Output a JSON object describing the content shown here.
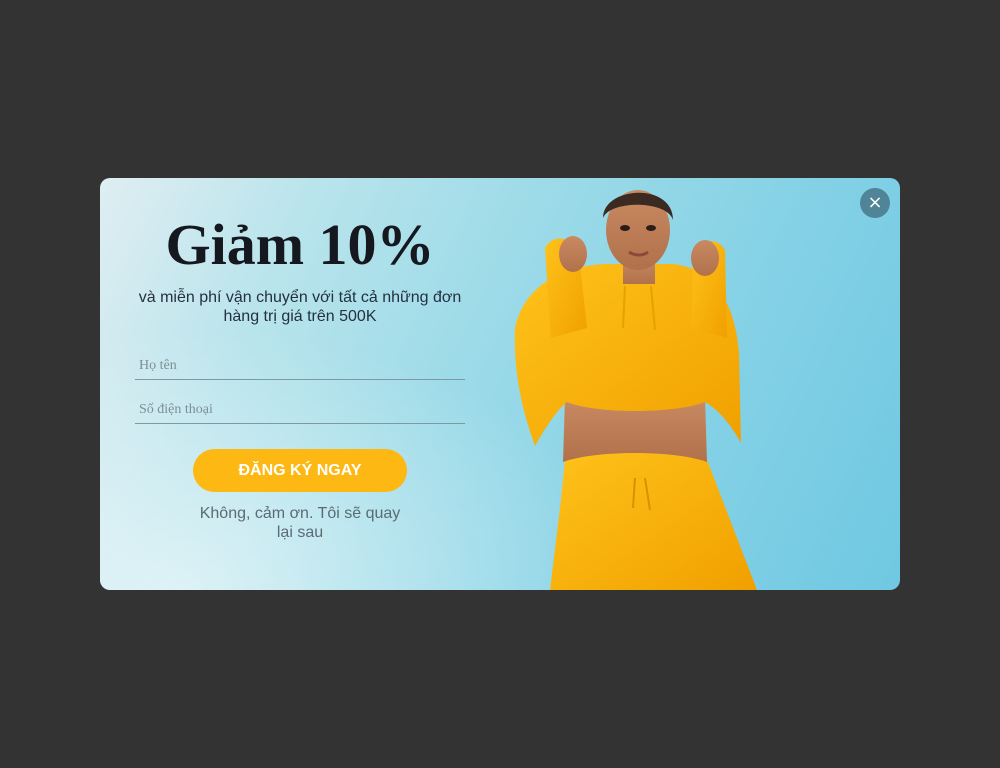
{
  "popup": {
    "headline": "Giảm 10%",
    "subline": "và miễn phí vận chuyển với tất cả những đơn hàng trị giá trên 500K",
    "name_placeholder": "Họ tên",
    "phone_placeholder": "Số điện thoại",
    "submit_label": "ĐĂNG KÝ NGAY",
    "dismiss_label": "Không, cảm ơn. Tôi sẽ quay lại sau",
    "close_symbol": "×",
    "close_icon": "close-icon",
    "image": "model-in-yellow-hoodie"
  },
  "colors": {
    "overlay": "#333333",
    "button": "#fdb813",
    "headline": "#15191f",
    "close_bg": "#4f8596"
  }
}
